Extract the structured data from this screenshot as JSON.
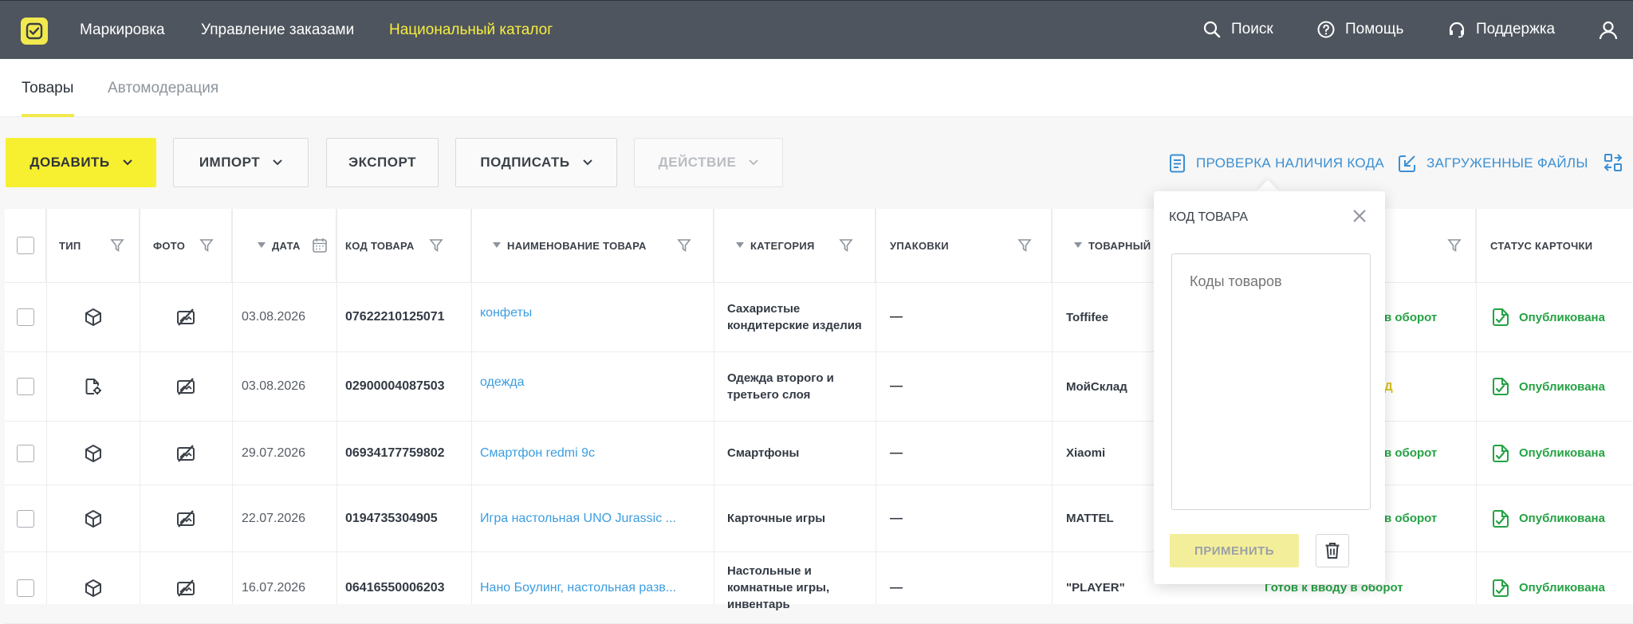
{
  "topbar": {
    "nav": [
      "Маркировка",
      "Управление заказами",
      "Национальный каталог"
    ],
    "search": "Поиск",
    "help": "Помощь",
    "support": "Поддержка",
    "active_color": "#f7ee3f"
  },
  "tabs": {
    "products": "Товары",
    "automoderation": "Автомодерация"
  },
  "toolbar": {
    "add": "ДОБАВИТЬ",
    "import": "ИМПОРТ",
    "export": "ЭКСПОРТ",
    "sign": "ПОДПИСАТЬ",
    "action": "ДЕЙСТВИЕ",
    "check_code": "ПРОВЕРКА НАЛИЧИЯ КОДА",
    "uploaded_files": "ЗАГРУЖЕННЫЕ ФАЙЛЫ"
  },
  "table": {
    "headers": {
      "type": "ТИП",
      "photo": "ФОТО",
      "date": "ДАТА",
      "code": "КОД ТОВАРА",
      "name": "НАИМЕНОВАНИЕ ТОВАРА",
      "category": "КАТЕГОРИЯ",
      "packages": "УПАКОВКИ",
      "brand": "ТОВАРНЫЙ",
      "card_status": "СТАТУС КАРТОЧКИ"
    },
    "rows": [
      {
        "type_icon": "box-icon",
        "date": "03.08.2026",
        "code": "07622210125071",
        "name": "конфеты",
        "category": "Сахаристые кондитерские изделия",
        "packages": "—",
        "brand": "Toffifee",
        "circulation": "в оборот",
        "circulation_color": "green",
        "card_status": "Опубликована"
      },
      {
        "type_icon": "document-gear-icon",
        "date": "03.08.2026",
        "code": "02900004087503",
        "name": "одежда",
        "category": "Одежда второго и третьего слоя",
        "packages": "—",
        "brand": "МойСклад",
        "circulation": "Д",
        "circulation_color": "yellow",
        "card_status": "Опубликована"
      },
      {
        "type_icon": "box-icon",
        "date": "29.07.2026",
        "code": "06934177759802",
        "name": "Смартфон redmi 9c",
        "category": "Смартфоны",
        "packages": "—",
        "brand": "Xiaomi",
        "circulation": "в оборот",
        "circulation_color": "green",
        "card_status": "Опубликована"
      },
      {
        "type_icon": "box-icon",
        "date": "22.07.2026",
        "code": "0194735304905",
        "name": "Игра настольная UNO Jurassic ...",
        "category": "Карточные игры",
        "packages": "—",
        "brand": "MATTEL",
        "circulation": "в оборот",
        "circulation_color": "green",
        "card_status": "Опубликована"
      },
      {
        "type_icon": "box-icon",
        "date": "16.07.2026",
        "code": "06416550006203",
        "name": "Нано Боулинг, настольная разв...",
        "category": "Настольные и комнатные игры, инвентарь",
        "packages": "—",
        "brand": "\"PLAYER\"",
        "circulation": "Готов к вводу в оборот",
        "circulation_color": "green",
        "card_status": "Опубликована"
      }
    ]
  },
  "popup": {
    "title": "КОД ТОВАРА",
    "placeholder": "Коды товаров",
    "apply": "ПРИМЕНИТЬ"
  }
}
